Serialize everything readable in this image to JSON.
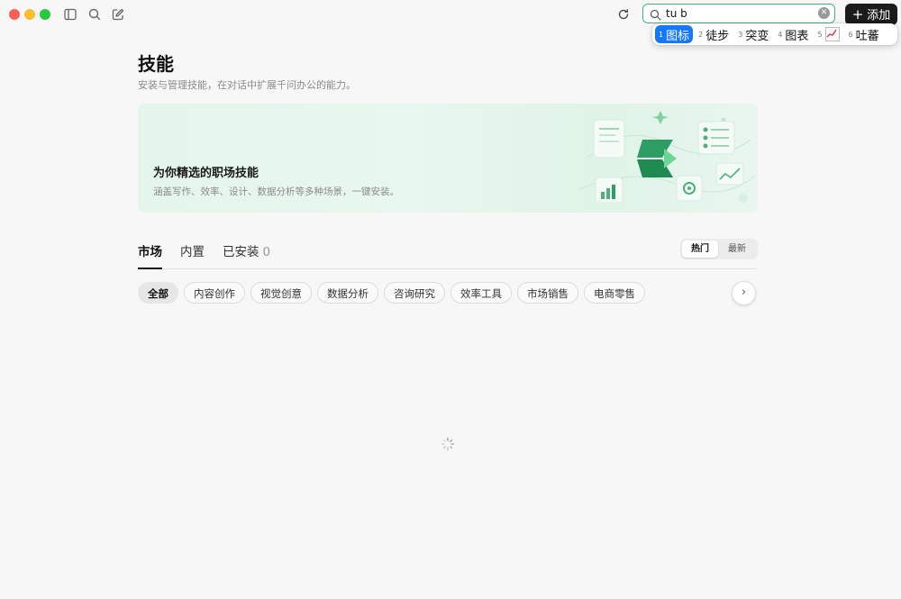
{
  "window": {
    "controls": [
      "close",
      "minimize",
      "zoom"
    ],
    "toolbar_icons": [
      "sidebar-icon",
      "search-icon",
      "compose-icon"
    ]
  },
  "header": {
    "refresh_icon": "refresh-icon",
    "search": {
      "value": "tu b",
      "placeholder": ""
    },
    "add_button": {
      "icon": "+",
      "label": "添加"
    }
  },
  "ime_candidates": [
    {
      "num": "1",
      "text": "图标",
      "selected": true
    },
    {
      "num": "2",
      "text": "徒步"
    },
    {
      "num": "3",
      "text": "突变"
    },
    {
      "num": "4",
      "text": "图表"
    },
    {
      "num": "5",
      "text": "",
      "emoji": "chart-increasing"
    },
    {
      "num": "6",
      "text": "吐蕃"
    }
  ],
  "page": {
    "title": "技能",
    "subtitle": "安装与管理技能，在对话中扩展千问办公的能力。"
  },
  "banner": {
    "title": "为你精选的职场技能",
    "description": "涵盖写作、效率、设计、数据分析等多种场景，一键安装。"
  },
  "tabs": {
    "market": "市场",
    "builtin": "内置",
    "installed": "已安装",
    "installed_count": "0"
  },
  "sort": {
    "hot": "热门",
    "latest": "最新"
  },
  "categories": [
    "全部",
    "内容创作",
    "视觉创意",
    "数据分析",
    "咨询研究",
    "效率工具",
    "市场销售",
    "电商零售"
  ],
  "colors": {
    "accent": "#4caf7c",
    "ime_selected": "#1677ff",
    "add_button_bg": "#1b1b1b"
  }
}
